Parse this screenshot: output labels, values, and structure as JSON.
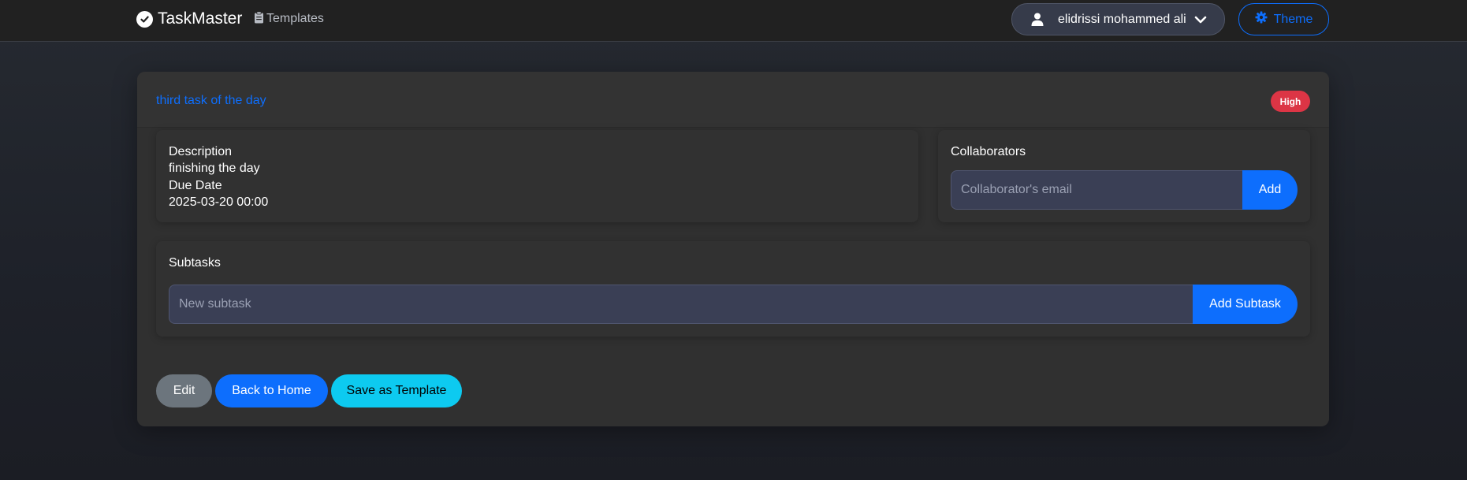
{
  "nav": {
    "brand": "TaskMaster",
    "templates_label": "Templates",
    "user_name": "elidrissi mohammed ali",
    "theme_label": "Theme"
  },
  "task": {
    "title": "third task of the day",
    "priority": "High",
    "description_label": "Description",
    "description": "finishing the day",
    "due_date_label": "Due Date",
    "due_date": "2025-03-20 00:00"
  },
  "collaborators": {
    "label": "Collaborators",
    "placeholder": "Collaborator's email",
    "add_label": "Add"
  },
  "subtasks": {
    "label": "Subtasks",
    "placeholder": "New subtask",
    "add_label": "Add Subtask"
  },
  "actions": {
    "edit": "Edit",
    "back_home": "Back to Home",
    "save_template": "Save as Template"
  },
  "colors": {
    "primary": "#0d6efd",
    "danger": "#dc3545",
    "info": "#0dcaf0",
    "secondary": "#6c757d"
  },
  "icons": {
    "brand": "check-circle-icon",
    "templates": "clipboard-icon",
    "user": "user-icon",
    "dropdown": "chevron-down-icon",
    "theme": "gear-icon"
  }
}
